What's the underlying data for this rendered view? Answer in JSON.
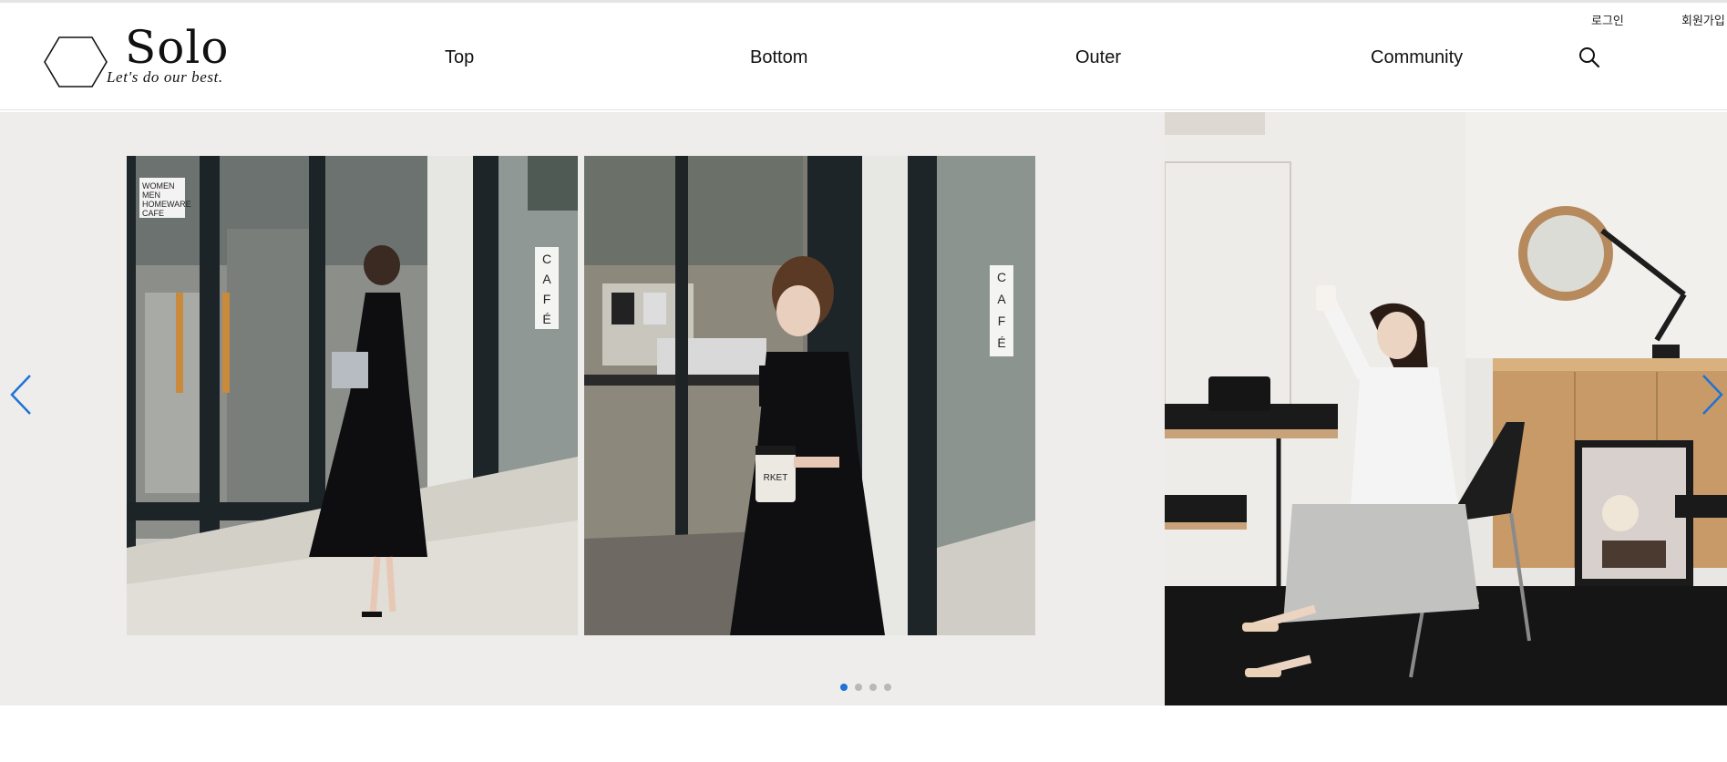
{
  "brand": {
    "name": "Solo",
    "tagline": "Let's do our best."
  },
  "util_links": {
    "login": "로그인",
    "signup": "회원가입"
  },
  "nav": [
    {
      "label": "Top"
    },
    {
      "label": "Bottom"
    },
    {
      "label": "Outer"
    },
    {
      "label": "Community"
    }
  ],
  "icons": {
    "search": "search-icon",
    "prev": "chevron-left-icon",
    "next": "chevron-right-icon",
    "logo": "hexagon-logo-icon"
  },
  "slider": {
    "slide_count": 4,
    "active_slide": 1,
    "photo_texts": {
      "window_sign": [
        "WOMEN",
        "MEN",
        "HOMEWARE",
        "CAFE"
      ],
      "cafe_sign": "CAFÉ",
      "cup_text": "RKET"
    }
  },
  "colors": {
    "accent": "#1e73d6",
    "hero_bg": "#efedec",
    "dot_inactive": "#b8b8b8"
  }
}
